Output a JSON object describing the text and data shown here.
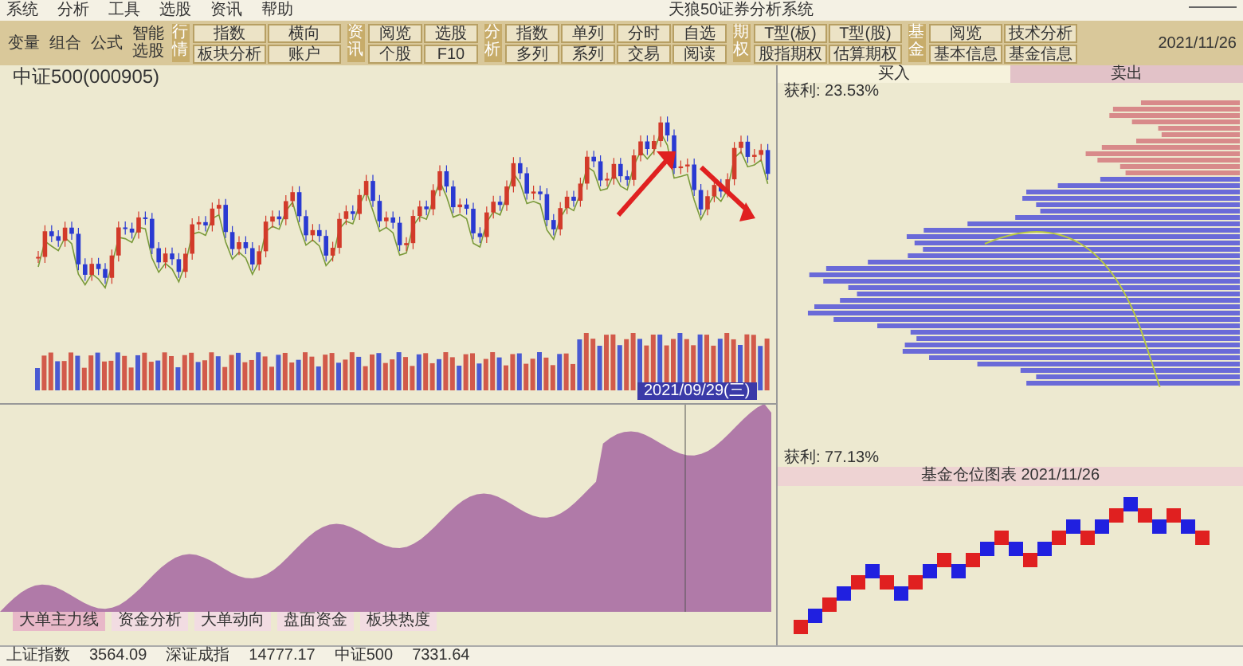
{
  "window": {
    "title": "天狼50证券分析系统"
  },
  "menu": [
    "系统",
    "分析",
    "工具",
    "选股",
    "资讯",
    "帮助"
  ],
  "quick_tools": [
    "变量",
    "组合",
    "公式",
    "智能选股"
  ],
  "toolbar_groups": [
    {
      "label": "行情",
      "buttons": [
        "指数",
        "横向",
        "板块分析",
        "账户"
      ]
    },
    {
      "label": "资讯",
      "buttons": [
        "阅览",
        "选股",
        "个股",
        "F10"
      ]
    },
    {
      "label": "分析",
      "buttons": [
        "指数",
        "单列",
        "分时",
        "自选",
        "多列",
        "系列",
        "交易",
        "阅读"
      ]
    },
    {
      "label": "期权",
      "buttons": [
        "T型(板)",
        "T型(股)",
        "股指期权",
        "估算期权"
      ]
    },
    {
      "label": "基金",
      "buttons": [
        "阅览",
        "技术分析",
        "基本信息",
        "基金信息"
      ]
    }
  ],
  "date": "2021/11/26",
  "chart": {
    "title": "中证500(000905)",
    "crosshair_date": "2021/09/29(三)"
  },
  "sub_tabs": [
    {
      "label": "大单主力线",
      "selected": true
    },
    {
      "label": "资金分析",
      "selected": false
    },
    {
      "label": "大单动向",
      "selected": false
    },
    {
      "label": "盘面资金",
      "selected": false
    },
    {
      "label": "板块热度",
      "selected": false
    }
  ],
  "right_tabs": [
    {
      "label": "买入",
      "selected": true
    },
    {
      "label": "卖出",
      "selected": false
    }
  ],
  "chips": {
    "top_label": "获利: 23.53%",
    "bottom_label": "获利: 77.13%"
  },
  "point_figure": {
    "title": "基金仓位图表 2021/11/26"
  },
  "status_bar": [
    "上证指数",
    "3564.09",
    "深证成指",
    "14777.17",
    "中证500",
    "7331.64"
  ]
}
